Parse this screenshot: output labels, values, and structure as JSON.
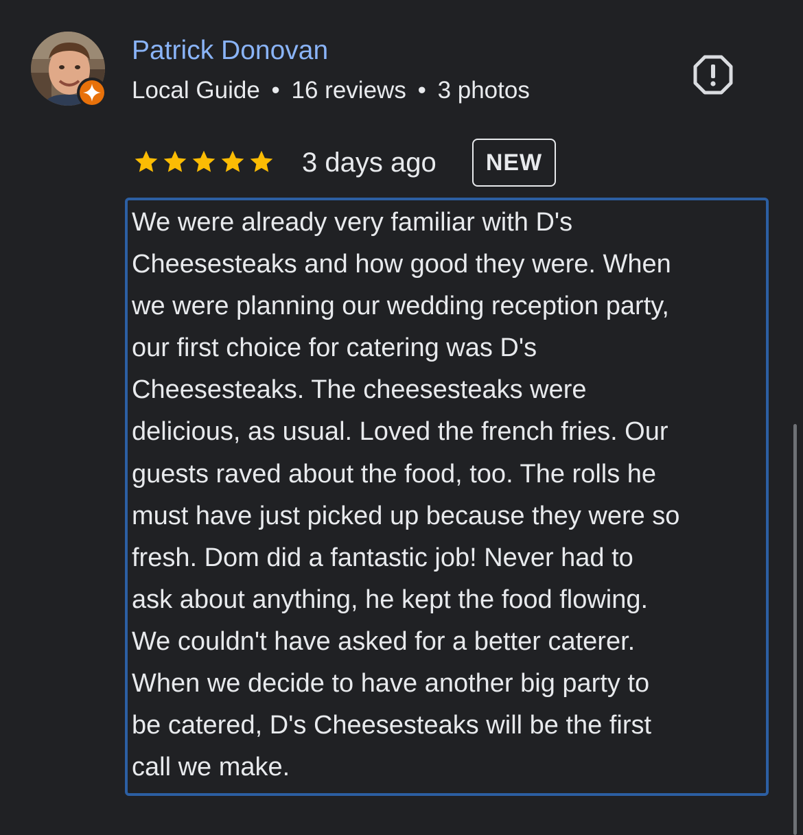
{
  "reviewer": {
    "name": "Patrick Donovan",
    "level": "Local Guide",
    "separator": "•",
    "reviews": "16 reviews",
    "photos": "3 photos"
  },
  "review": {
    "rating": 5,
    "rating_max": 5,
    "date": "3 days ago",
    "badge": "NEW",
    "lines": [
      "We were already very familiar with D's",
      "Cheesesteaks and how good they were. When",
      "we were planning our wedding reception party,",
      "our first choice for catering was D's",
      "Cheesesteaks. The cheesesteaks were",
      "delicious, as usual. Loved the french fries. Our",
      "guests raved about the food, too. The rolls he",
      "must have just picked up because they were so",
      "fresh. Dom did a fantastic job! Never had to",
      "ask about anything, he kept the food flowing.",
      "We couldn't have asked for a better caterer.",
      "When we decide to have another big party to",
      "be catered, D's Cheesesteaks will be the first",
      "call we make."
    ]
  },
  "icons": {
    "report": "report-flag-icon",
    "guide_badge": "local-guide-star-icon",
    "star": "star-icon"
  },
  "colors": {
    "background": "#202124",
    "name": "#8ab4f8",
    "text": "#e8eaed",
    "star": "#fbbc04",
    "highlight_border": "#2c5fa3",
    "badge_orange": "#e8710a"
  }
}
